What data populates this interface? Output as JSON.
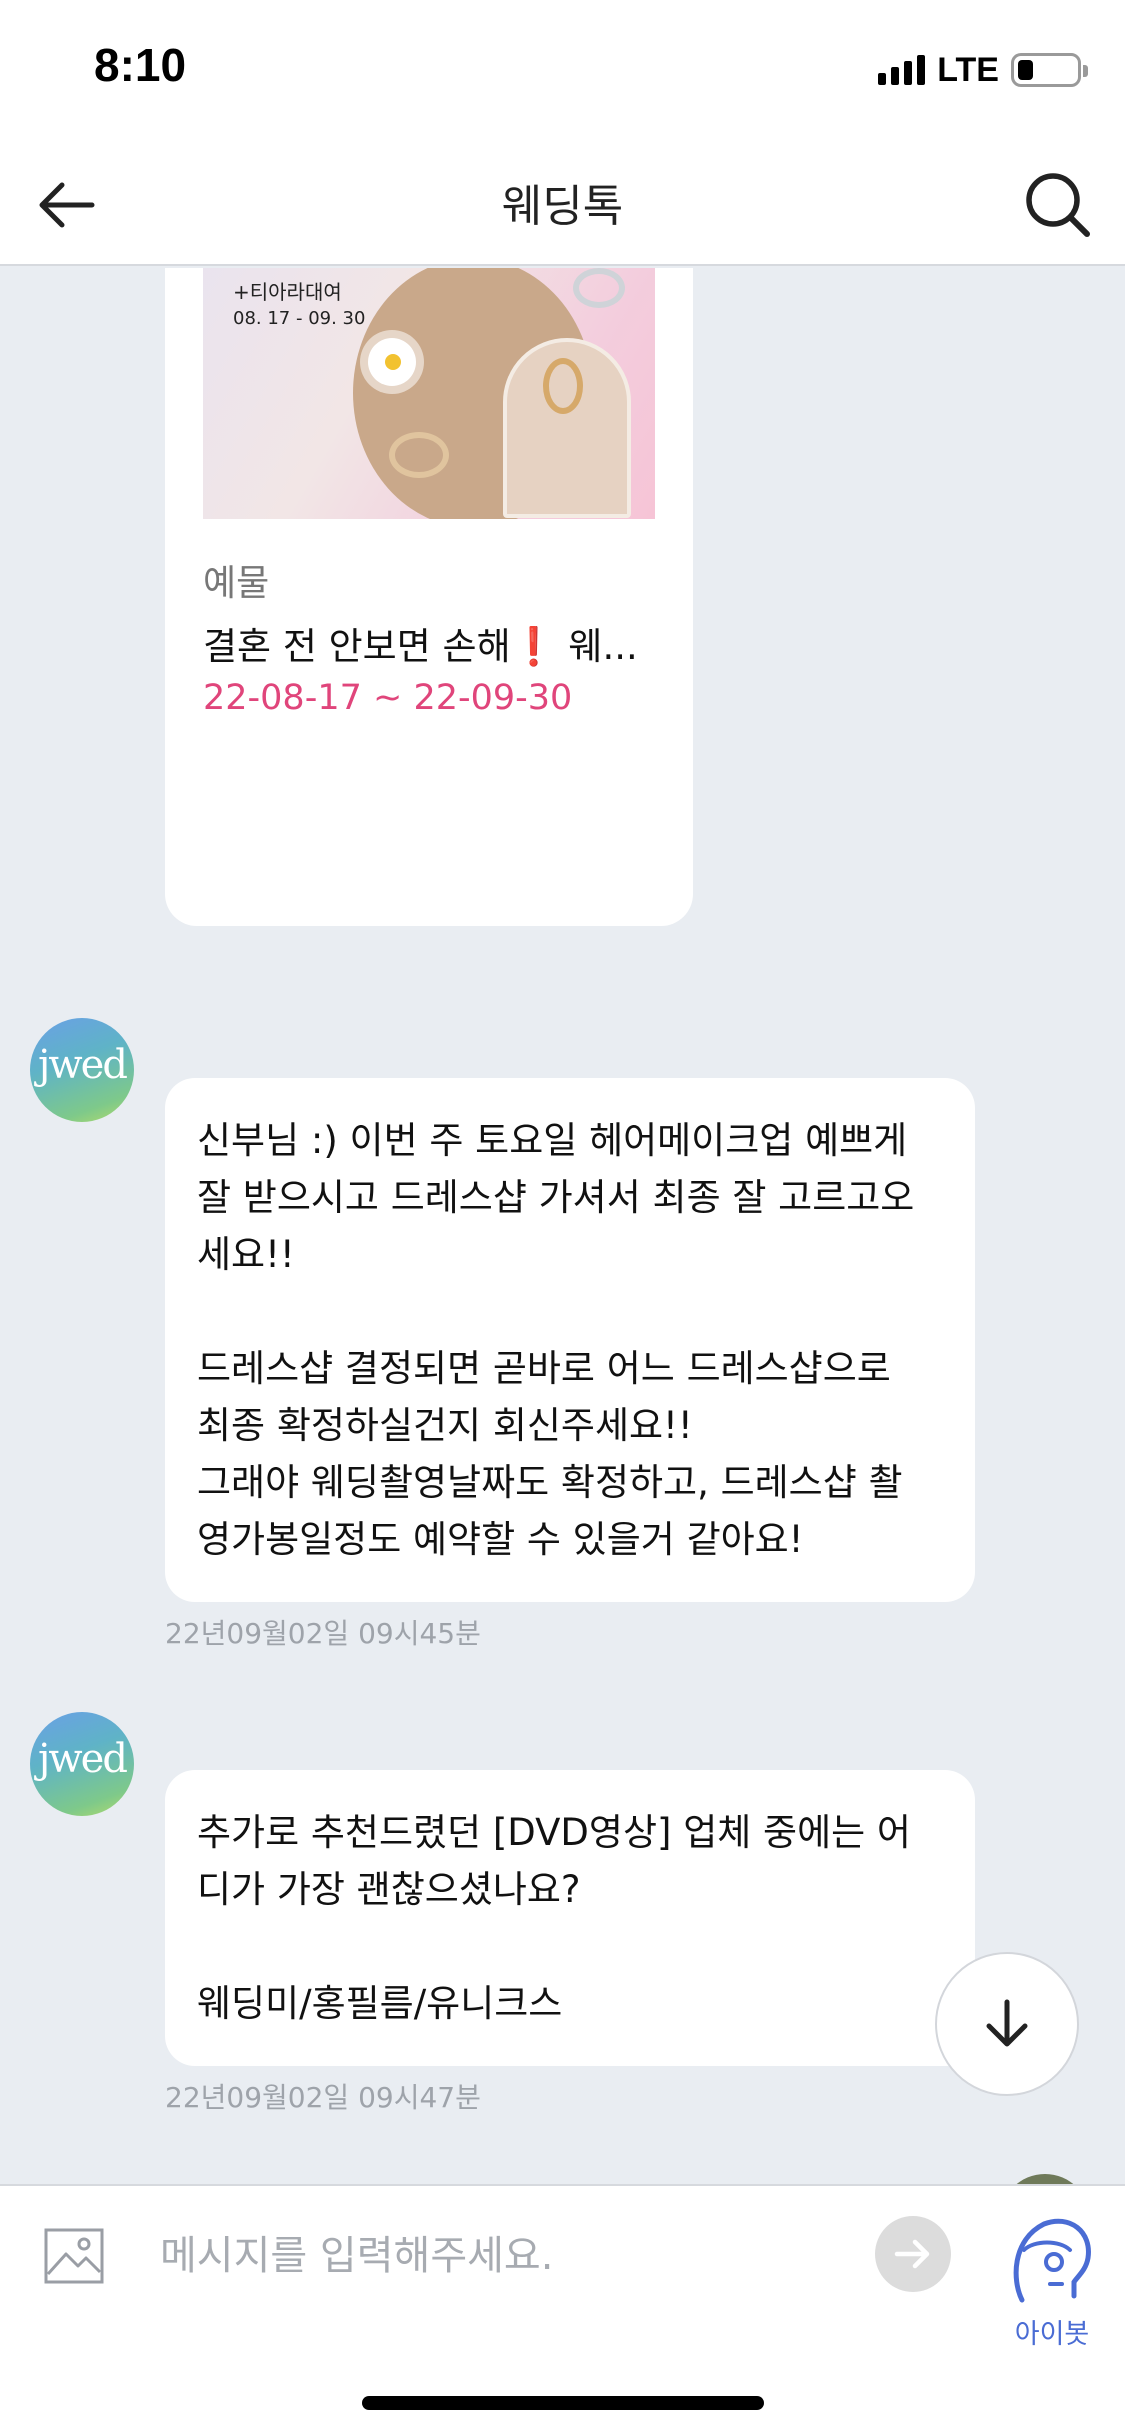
{
  "status_bar": {
    "time": "8:10",
    "network": "LTE",
    "battery_level": 0.25
  },
  "header": {
    "title": "웨딩톡",
    "back_icon": "arrow-left-icon",
    "search_icon": "search-icon"
  },
  "promo_card": {
    "image_text": [
      "+티아라대여",
      "08. 17 - 09. 30"
    ],
    "brand": "예물",
    "title": "결혼 전 안보면 손해❗️ 웨...",
    "date_range": "22-08-17 ~ 22-09-30",
    "date_color": "#e0457b"
  },
  "messages": [
    {
      "sender_avatar": "jwedding",
      "lines": [
        "신부님 :) 이번 주 토요일 헤어메이크업 예쁘게",
        "잘 받으시고 드레스샵 가셔서 최종 잘 고르고오",
        "세요!!",
        "",
        "드레스샵 결정되면 곧바로 어느 드레스샵으로",
        "최종 확정하실건지 회신주세요!!",
        "그래야 웨딩촬영날짜도 확정하고, 드레스샵 촬",
        "영가봉일정도 예약할 수 있을거 같아요!"
      ],
      "timestamp": "22년09월02일 09시45분"
    },
    {
      "sender_avatar": "jwedding",
      "lines": [
        "추가로 추천드렸던 [DVD영상] 업체 중에는 어",
        "디가 가장 괜찮으셨나요?",
        "",
        "웨딩미/홍필름/유니크스"
      ],
      "timestamp": "22년09월02일 09시47분"
    }
  ],
  "input_bar": {
    "placeholder": "메시지를 입력해주세요.",
    "image_icon": "image-icon",
    "send_icon": "send-arrow-icon",
    "bot_label": "아이봇",
    "accent_color": "#4a6cd4"
  },
  "scroll_down_icon": "arrow-down-icon"
}
